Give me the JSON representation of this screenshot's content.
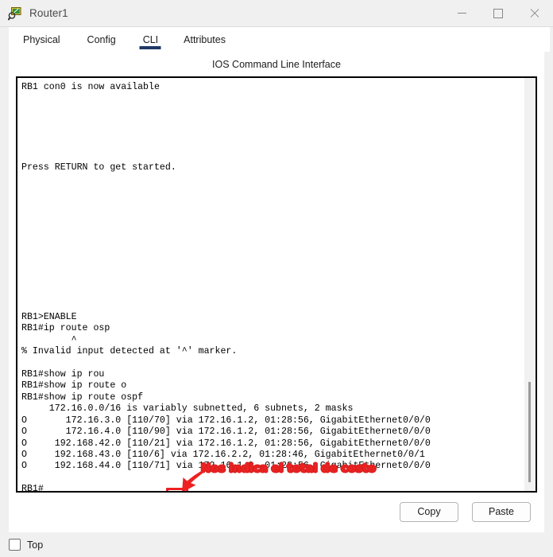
{
  "window": {
    "title": "Router1",
    "icon": "packet-tracer-router-icon",
    "controls": {
      "minimize": "minimize-icon",
      "maximize": "maximize-icon",
      "close": "close-icon"
    }
  },
  "tabs": [
    {
      "label": "Physical",
      "active": false
    },
    {
      "label": "Config",
      "active": false
    },
    {
      "label": "CLI",
      "active": true
    },
    {
      "label": "Attributes",
      "active": false
    }
  ],
  "cli": {
    "heading": "IOS Command Line Interface",
    "lines": [
      "RB1 con0 is now available",
      "",
      "",
      "",
      "",
      "",
      "",
      "Press RETURN to get started.",
      "",
      "",
      "",
      "",
      "",
      "",
      "",
      "",
      "",
      "",
      "",
      "",
      "RB1>ENABLE",
      "RB1#ip route osp",
      "         ^",
      "% Invalid input detected at '^' marker.",
      "",
      "RB1#show ip rou",
      "RB1#show ip route o",
      "RB1#show ip route ospf",
      "     172.16.0.0/16 is variably subnetted, 6 subnets, 2 masks",
      "O       172.16.3.0 [110/70] via 172.16.1.2, 01:28:56, GigabitEthernet0/0/0",
      "O       172.16.4.0 [110/90] via 172.16.1.2, 01:28:56, GigabitEthernet0/0/0",
      "O     192.168.42.0 [110/21] via 172.16.1.2, 01:28:56, GigabitEthernet0/0/0",
      "O     192.168.43.0 [110/6] via 172.16.2.2, 01:28:46, GigabitEthernet0/0/1",
      "O     192.168.44.0 [110/71] via 172.16.1.2, 01:28:56, GigabitEthernet0/0/0",
      "",
      "RB1#"
    ],
    "scrollbar": "vertical-scrollbar"
  },
  "annotation": {
    "text": "Nos indica el total de costo",
    "highlight_value": "70",
    "color": "#ee2020",
    "arrow": "arrow-pointing-down-left"
  },
  "buttons": {
    "copy": "Copy",
    "paste": "Paste"
  },
  "statusbar": {
    "top_label": "Top",
    "top_checked": false
  }
}
